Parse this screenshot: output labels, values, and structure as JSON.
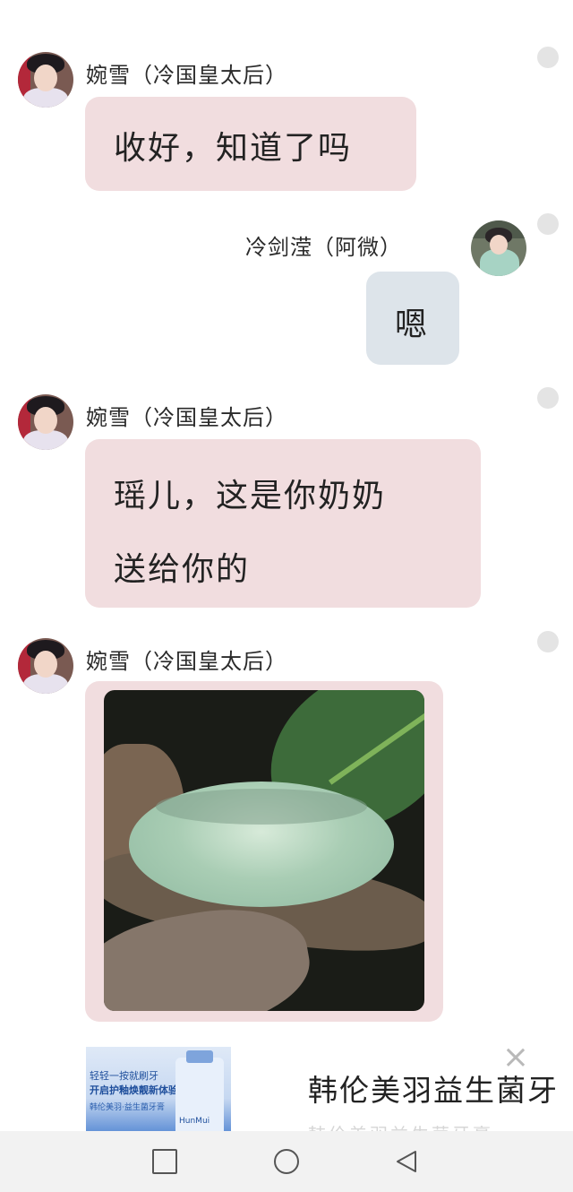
{
  "messages": [
    {
      "sender": "婉雪（冷国皇太后）",
      "text": "收好，知道了吗",
      "side": "left"
    },
    {
      "sender": "冷剑滢（阿微）",
      "text": "嗯",
      "side": "right"
    },
    {
      "sender": "婉雪（冷国皇太后）",
      "line1": "瑶儿，这是你奶奶",
      "line2": "送给你的",
      "side": "left"
    },
    {
      "sender": "婉雪（冷国皇太后）",
      "image_alt": "jade bangle photo",
      "side": "left"
    }
  ],
  "ad": {
    "thumb_line1": "轻轻一按就刷牙",
    "thumb_line2": "开启护釉焕靓新体验",
    "thumb_line3": "韩伦美羽·益生菌牙膏",
    "thumb_brand": "HunMui",
    "title": "韩伦美羽益生菌牙",
    "close_icon": "×",
    "faded_text": "韩伦美羽益生菌牙膏"
  },
  "colors": {
    "bubble_pink": "#f1dddf",
    "bubble_blue": "#dde4ea",
    "nav_bg": "#f2f2f2"
  }
}
